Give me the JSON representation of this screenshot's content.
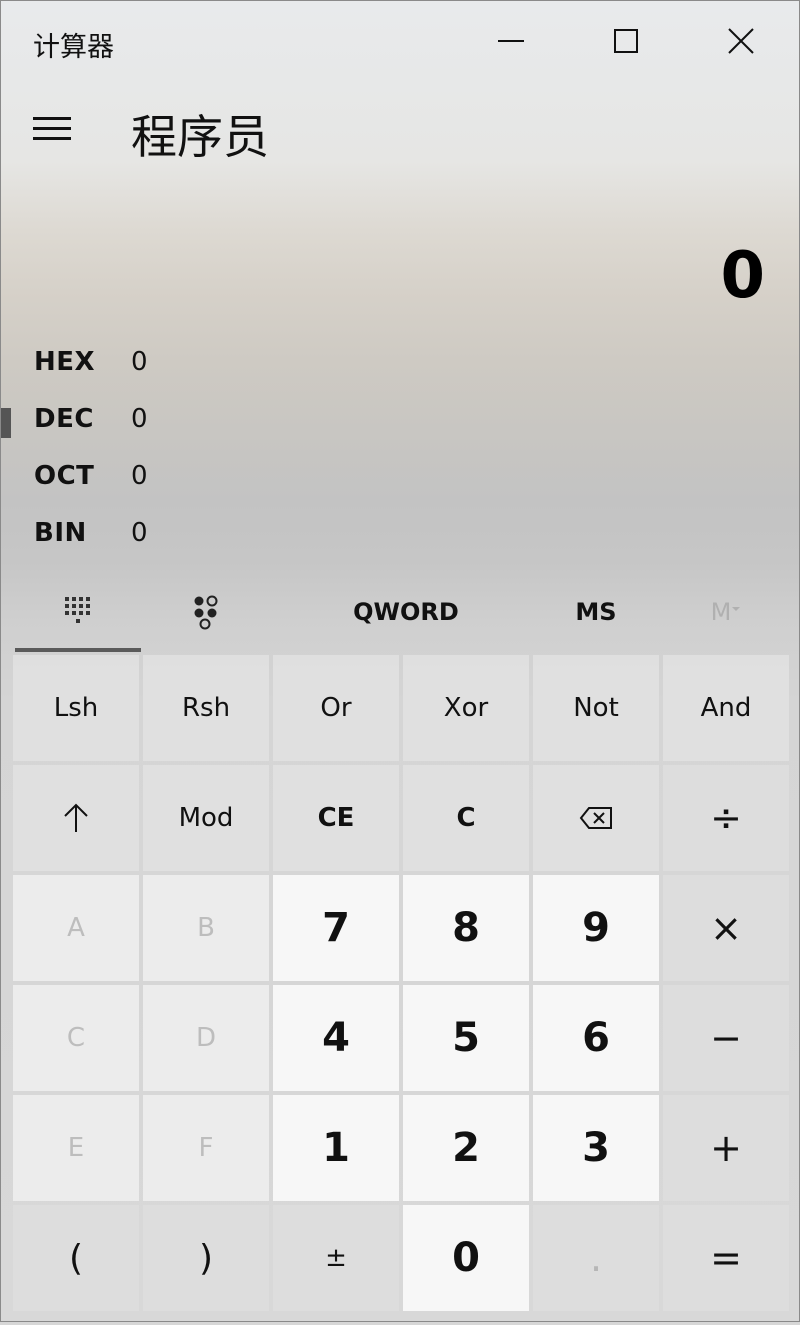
{
  "window": {
    "title": "计算器",
    "controls": [
      "minimize",
      "maximize",
      "close"
    ]
  },
  "header": {
    "menu_icon": "hamburger-icon",
    "mode_title": "程序员"
  },
  "display": {
    "value": "0"
  },
  "radix": [
    {
      "name": "HEX",
      "value": "0",
      "selected": false
    },
    {
      "name": "DEC",
      "value": "0",
      "selected": true
    },
    {
      "name": "OCT",
      "value": "0",
      "selected": false
    },
    {
      "name": "BIN",
      "value": "0",
      "selected": false
    }
  ],
  "keypad_tabs": {
    "full_keypad_icon": "keypad-grid-icon",
    "bit_toggle_icon": "bit-toggle-icon",
    "word_size": "QWORD",
    "memory_store": "MS",
    "memory_recall": "M"
  },
  "keys": {
    "lsh": "Lsh",
    "rsh": "Rsh",
    "or": "Or",
    "xor": "Xor",
    "not": "Not",
    "and": "And",
    "shift": "↑",
    "mod": "Mod",
    "ce": "CE",
    "clear": "C",
    "divide": "÷",
    "a": "A",
    "b": "B",
    "seven": "7",
    "eight": "8",
    "nine": "9",
    "multiply": "×",
    "c": "C",
    "d": "D",
    "four": "4",
    "five": "5",
    "six": "6",
    "minus": "−",
    "e": "E",
    "f": "F",
    "one": "1",
    "two": "2",
    "three": "3",
    "plus": "+",
    "lparen": "(",
    "rparen": ")",
    "negate": "±",
    "zero": "0",
    "decimal": ".",
    "equals": "="
  },
  "colors": {
    "number_key_bg": "#f7f7f7",
    "disabled_text": "#bdbdbd",
    "selection_indicator": "#555555"
  }
}
